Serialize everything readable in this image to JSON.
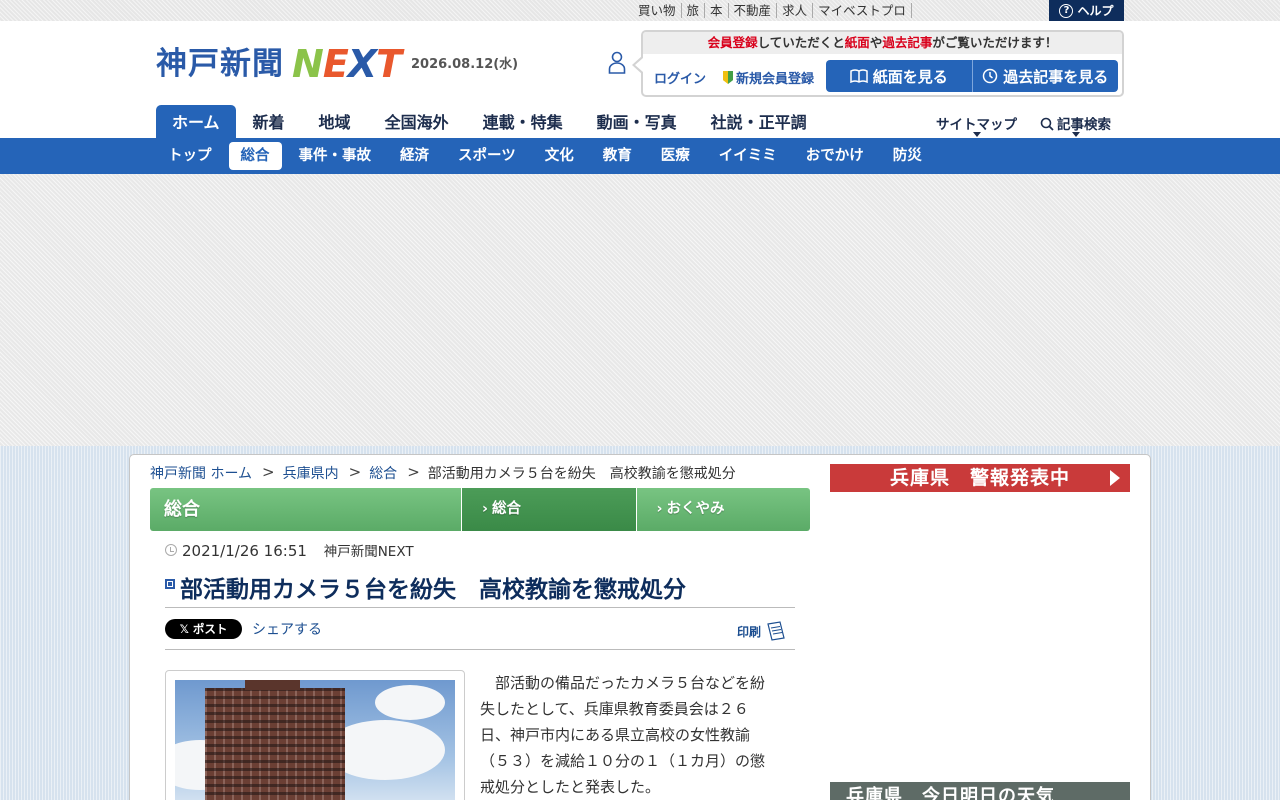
{
  "utility": {
    "links": [
      "買い物",
      "旅",
      "本",
      "不動産",
      "求人",
      "マイベストプロ"
    ],
    "help": "ヘルプ"
  },
  "header": {
    "logo_kanji": "神戸新聞",
    "logo_next": [
      "N",
      "E",
      "X",
      "T"
    ],
    "date": "2026.08.12(水)",
    "member_message": {
      "part1": "会員登録",
      "part2": "していただくと",
      "part3": "紙面",
      "part4": "や",
      "part5": "過去記事",
      "part6": "がご覧いただけます！"
    },
    "login": "ログイン",
    "register": "新規会員登録",
    "view_paper": "紙面を見る",
    "view_archive": "過去記事を見る"
  },
  "main_nav": {
    "items": [
      "ホーム",
      "新着",
      "地域",
      "全国海外",
      "連載・特集",
      "動画・写真",
      "社説・正平調"
    ],
    "active_index": 0,
    "sitemap": "サイトマップ",
    "search": "記事検索"
  },
  "sub_nav": {
    "items": [
      "トップ",
      "総合",
      "事件・事故",
      "経済",
      "スポーツ",
      "文化",
      "教育",
      "医療",
      "イイミミ",
      "おでかけ",
      "防災"
    ],
    "active_index": 1
  },
  "breadcrumb": [
    "神戸新聞 ホーム",
    "兵庫県内",
    "総合",
    "部活動用カメラ５台を紛失　高校教諭を懲戒処分"
  ],
  "category": {
    "title": "総合",
    "tabs": [
      "総合",
      "おくやみ"
    ],
    "active_index": 0
  },
  "article": {
    "datetime": "2021/1/26 16:51",
    "source": "神戸新聞NEXT",
    "headline": "部活動用カメラ５台を紛失　高校教諭を懲戒処分",
    "post_label": "ポスト",
    "share_label": "シェアする",
    "print_label": "印刷",
    "body_lines": [
      "　部活動の備品だったカメラ５台などを紛",
      "失したとして、兵庫県教育委員会は２６",
      "日、神戸市内にある県立高校の女性教諭",
      "（５３）を減給１０分の１（１カ月）の懲",
      "戒処分としたと発表した。"
    ]
  },
  "sidebar": {
    "alert": "兵庫県　警報発表中",
    "weather": "兵庫県　今日明日の天気"
  },
  "colors": {
    "brand_blue": "#2564b8",
    "navy": "#0e2d5c",
    "category_green": "#5bab67",
    "alert_red": "#c93a3a"
  }
}
